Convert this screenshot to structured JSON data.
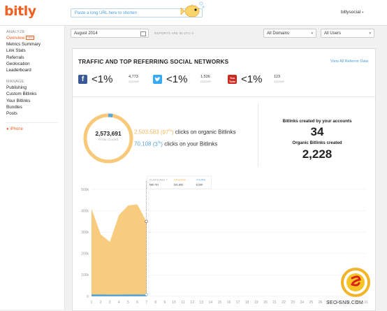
{
  "header": {
    "logo": "bitly",
    "shorten_placeholder": "Paste a long URL here to shorten",
    "user": "bitlysocial"
  },
  "sidebar": {
    "analyze_heading": "ANALYZE",
    "analyze_items": [
      {
        "label": "Overview",
        "active": true,
        "tag": "NEW"
      },
      {
        "label": "Metrics Summary"
      },
      {
        "label": "Link Stats"
      },
      {
        "label": "Referrals"
      },
      {
        "label": "Geolocation"
      },
      {
        "label": "Leaderboard"
      }
    ],
    "manage_heading": "MANAGE",
    "manage_items": [
      {
        "label": "Publishing"
      },
      {
        "label": "Custom Bitlinks"
      },
      {
        "label": "Your Bitlinks"
      },
      {
        "label": "Bundles"
      },
      {
        "label": "Posts"
      }
    ],
    "iphone": "iPhone"
  },
  "filters": {
    "date": "August 2014",
    "timezone": "REPORTS ARE IN UTC-4",
    "domains": "All Domains",
    "users": "All Users"
  },
  "panel": {
    "title": "TRAFFIC AND TOP REFERRING SOCIAL NETWORKS",
    "link": "View All Referrer Data",
    "networks": [
      {
        "name": "facebook",
        "icon": "facebook-icon",
        "pct": "<1%",
        "clicks": "4,773",
        "label": "CLICKS",
        "color": "#3b5998"
      },
      {
        "name": "twitter",
        "icon": "twitter-icon",
        "pct": "<1%",
        "clicks": "1,536",
        "label": "CLICKS",
        "color": "#33aaf3"
      },
      {
        "name": "youtube",
        "icon": "youtube-icon",
        "pct": "<1%",
        "clicks": "123",
        "label": "CLICKS",
        "color": "#cc2a1f"
      }
    ],
    "total_clicks": "2,573,691",
    "total_label": "TOTAL CLICKS",
    "organic": {
      "clicks": "2,503,583",
      "pct": "97",
      "text": "clicks on organic Bitlinks"
    },
    "yours": {
      "clicks": "70,108",
      "pct": "3",
      "text": "clicks on your Bitlinks"
    },
    "accounts_label": "Bitlinks created by your accounts",
    "accounts_value": "34",
    "organic_created_label": "Organic Bitlinks created",
    "organic_created_value": "2,228"
  },
  "tooltip": {
    "date": "CLICKS AUG 7",
    "total": "580,791",
    "organic_label": "ORGANIC",
    "organic_value": "531,852",
    "yours_label": "YOURS",
    "yours_value": "8,339"
  },
  "chart_data": {
    "type": "area",
    "x": [
      1,
      2,
      3,
      4,
      5,
      6,
      7,
      8,
      9,
      10,
      11,
      12,
      13,
      14,
      15,
      16,
      17,
      18,
      19,
      20,
      21,
      22,
      23,
      24,
      25,
      26,
      27,
      28,
      29,
      30,
      31
    ],
    "yticks": [
      "0",
      "100k",
      "200k",
      "300k",
      "400k",
      "500k"
    ],
    "ylim": [
      0,
      500000
    ],
    "series": [
      {
        "name": "ORGANIC",
        "color": "#f8c978",
        "values": [
          410000,
          290000,
          255000,
          380000,
          425000,
          430000,
          350000
        ]
      },
      {
        "name": "YOURS",
        "color": "#5ba4d6",
        "values": [
          9000,
          9000,
          8000,
          8000,
          9000,
          9000,
          8339
        ]
      }
    ]
  },
  "watermark": "SEO-SNS.COM"
}
